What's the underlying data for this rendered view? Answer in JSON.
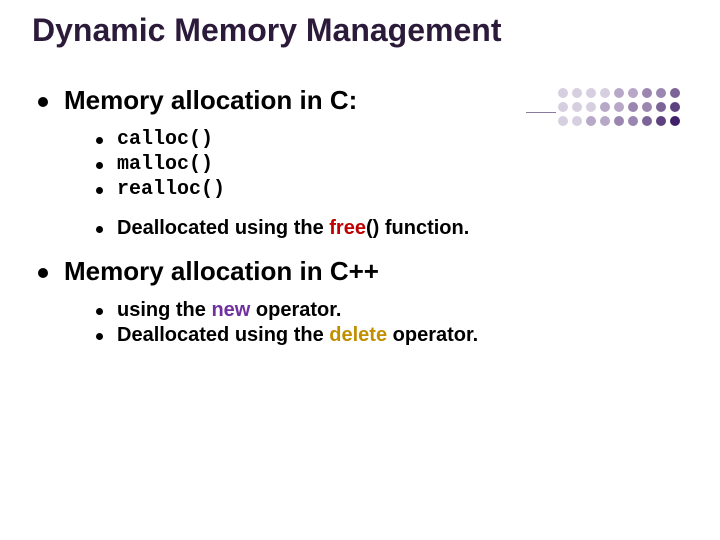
{
  "title": "Dynamic Memory Management",
  "section1": {
    "heading": "Memory allocation in C:",
    "items": [
      "calloc()",
      "malloc()",
      "realloc()"
    ],
    "dealloc_prefix": "Deallocated using the ",
    "dealloc_kw": "free",
    "dealloc_suffix": "() function."
  },
  "section2": {
    "heading": "Memory allocation in C++",
    "line1_prefix": "using the ",
    "line1_kw": "new",
    "line1_suffix": " operator.",
    "line2_prefix": "Deallocated using the ",
    "line2_kw": "delete",
    "line2_suffix": " operator."
  },
  "decoration_colors": {
    "row1": [
      "#d6cfe0",
      "#d6cfe0",
      "#d6cfe0",
      "#d6cfe0",
      "#b8a8c8",
      "#b8a8c8",
      "#9a86b0",
      "#9a86b0",
      "#7c6498"
    ],
    "row2": [
      "#d6cfe0",
      "#d6cfe0",
      "#d6cfe0",
      "#b8a8c8",
      "#b8a8c8",
      "#9a86b0",
      "#9a86b0",
      "#7c6498",
      "#5e4280"
    ],
    "row3": [
      "#d6cfe0",
      "#d6cfe0",
      "#b8a8c8",
      "#b8a8c8",
      "#9a86b0",
      "#9a86b0",
      "#7c6498",
      "#5e4280",
      "#402068"
    ]
  }
}
